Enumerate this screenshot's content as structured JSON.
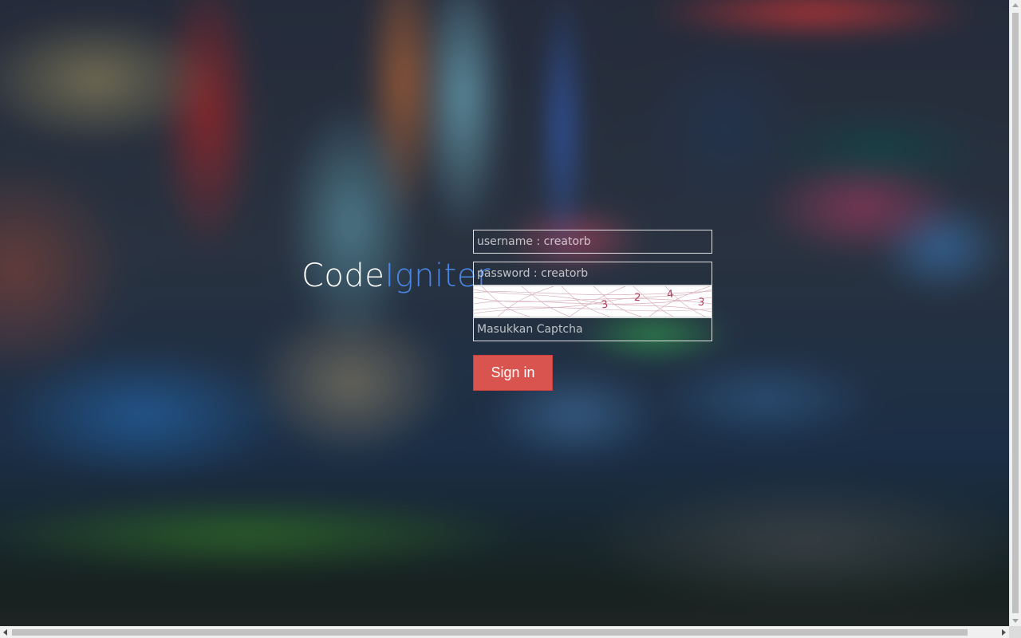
{
  "logo": {
    "part1": "Code",
    "part2": "Igniter",
    "part1_color": "#ffffff",
    "part2_color": "#4a86e8"
  },
  "form": {
    "username_placeholder": "username : creatorb",
    "password_placeholder": "password : creatorb",
    "captcha_placeholder": "Masukkan Captcha",
    "captcha_chars": [
      "3",
      "2",
      "4",
      "3"
    ],
    "signin_label": "Sign in",
    "signin_color": "#d9534f"
  },
  "background": {
    "description_icon": "blurred-city-street-image"
  }
}
